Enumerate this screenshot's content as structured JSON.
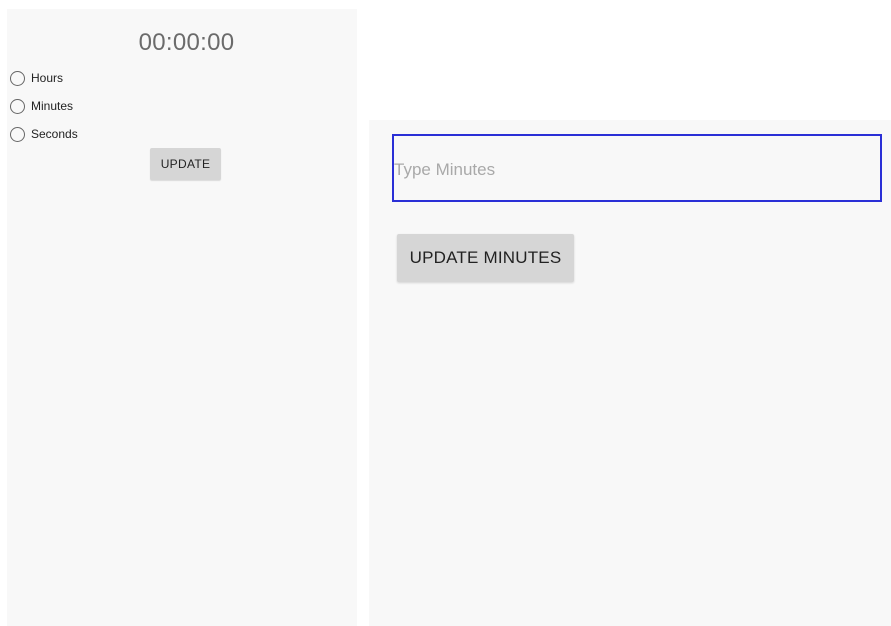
{
  "timer_screen": {
    "display": "00:00:00",
    "radio_options": [
      {
        "label": "Hours",
        "checked": false
      },
      {
        "label": "Minutes",
        "checked": false
      },
      {
        "label": "Seconds",
        "checked": false
      }
    ],
    "update_label": "UPDATE"
  },
  "minutes_screen": {
    "input_placeholder": "Type Minutes",
    "input_value": "",
    "update_minutes_label": "UPDATE MINUTES",
    "input_border_color": "#2a2fd6"
  }
}
